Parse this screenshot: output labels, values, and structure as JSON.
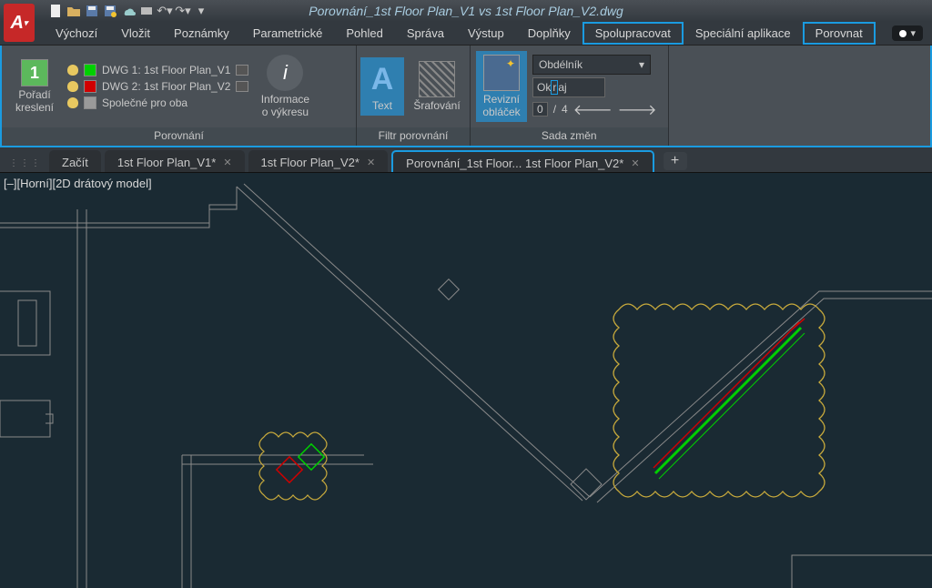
{
  "title": "Porovnání_1st Floor Plan_V1 vs 1st Floor Plan_V2.dwg",
  "app_letter": "A",
  "menu": {
    "items": [
      {
        "label": "Výchozí"
      },
      {
        "label": "Vložit"
      },
      {
        "label": "Poznámky"
      },
      {
        "label": "Parametrické"
      },
      {
        "label": "Pohled"
      },
      {
        "label": "Správa"
      },
      {
        "label": "Výstup"
      },
      {
        "label": "Doplňky"
      },
      {
        "label": "Spolupracovat"
      },
      {
        "label": "Speciální aplikace"
      },
      {
        "label": "Porovnat"
      }
    ]
  },
  "ribbon": {
    "draw_order": {
      "label_line1": "Pořadí",
      "label_line2": "kreslení",
      "number": "1"
    },
    "legend": {
      "dwg1": "DWG 1:  1st Floor Plan_V1",
      "dwg2": "DWG 2:  1st Floor Plan_V2",
      "common": "Společné pro oba"
    },
    "panel_compare": "Porovnání",
    "info": {
      "line1": "Informace",
      "line2": "o výkresu"
    },
    "text_btn": "Text",
    "hatch_btn": "Šrafování",
    "revcloud": {
      "line1": "Revizní",
      "line2": "obláček"
    },
    "panel_filter": "Filtr porovnání",
    "shape_dropdown": "Obdélník",
    "margin_label": "Okraj",
    "nav": {
      "current": "0",
      "sep": "/",
      "total": "4"
    },
    "panel_changes": "Sada změn"
  },
  "file_tabs": [
    {
      "label": "Začít",
      "closable": false
    },
    {
      "label": "1st Floor Plan_V1*",
      "closable": true
    },
    {
      "label": "1st Floor Plan_V2*",
      "closable": true
    },
    {
      "label": "Porovnání_1st Floor... 1st Floor Plan_V2*",
      "closable": true,
      "active": true
    }
  ],
  "viewport_label": "[–][Horní][2D drátový model]",
  "colors": {
    "highlight_blue": "#1a9be0",
    "dwg1_green": "#00d000",
    "dwg2_red": "#d00000",
    "common_grey": "#9a9a9a",
    "revcloud_yellow": "#c8aa3c"
  }
}
